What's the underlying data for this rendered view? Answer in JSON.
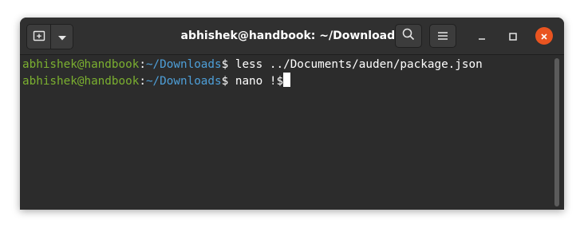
{
  "window": {
    "title": "abhishek@handbook: ~/Downloads"
  },
  "headerbar": {
    "new_tab_icon": "new-tab-icon",
    "menu_dropdown_icon": "chevron-down-icon",
    "search_icon": "search-icon",
    "hamburger_icon": "hamburger-menu-icon",
    "minimize_icon": "minimize-icon",
    "maximize_icon": "maximize-icon",
    "close_icon": "close-icon"
  },
  "colors": {
    "user_host": "#7bb030",
    "path": "#4e9fd8",
    "close_button": "#e95420",
    "background": "#2c2c2c"
  },
  "terminal": {
    "lines": [
      {
        "user_host": "abhishek@handbook",
        "colon": ":",
        "path": "~/Downloads",
        "prompt": "$",
        "command": " less ../Documents/auden/package.json"
      },
      {
        "user_host": "abhishek@handbook",
        "colon": ":",
        "path": "~/Downloads",
        "prompt": "$",
        "command": " nano !$"
      }
    ]
  }
}
